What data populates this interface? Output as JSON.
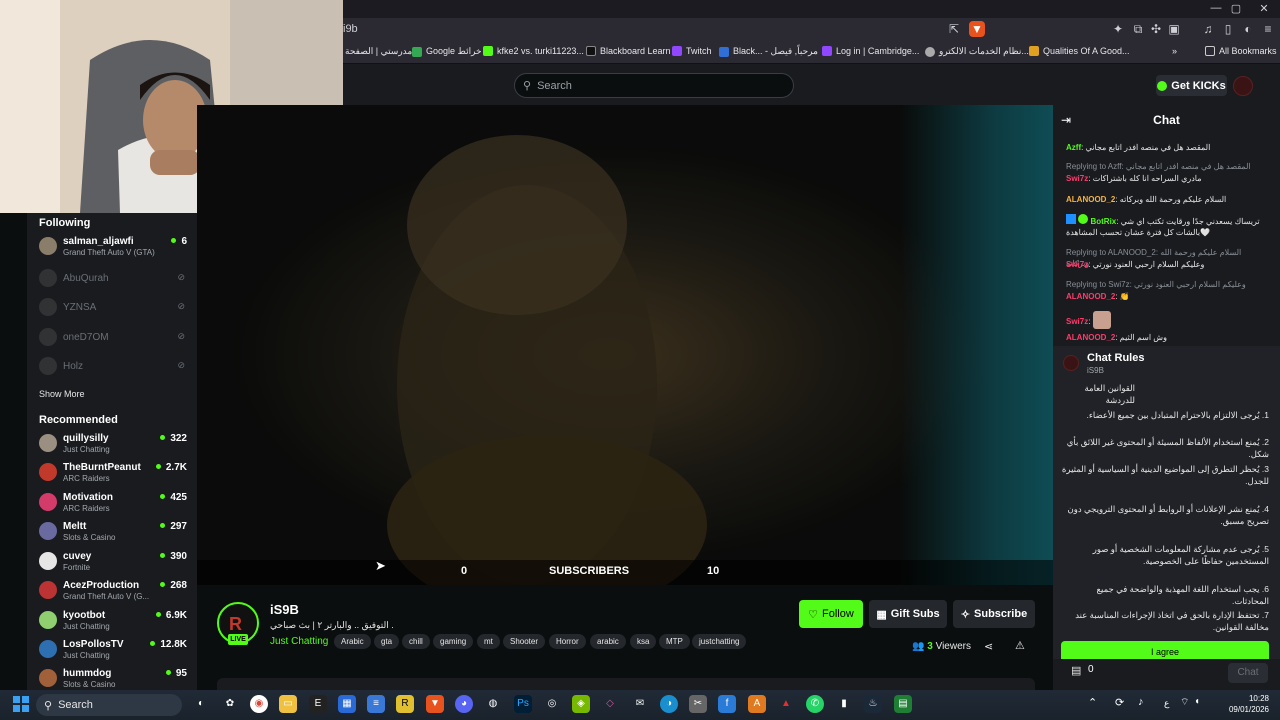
{
  "browser": {
    "url_partial": "i9b",
    "bookmarks": [
      "مدرستي | الصفحة",
      "Google خرائط",
      "kfke2 vs. turki11223...",
      "Blackboard Learn",
      "Twitch",
      "Black... - مرحباً, فيصل",
      "Log in | Cambridge...",
      "نظام الخدمات الالكترو...",
      "Qualities Of A Good...",
      "All Bookmarks"
    ],
    "window_controls": [
      "—",
      "▢",
      "✕"
    ]
  },
  "header": {
    "search_placeholder": "Search",
    "get_kicks_label": "Get KICKs"
  },
  "sidebar": {
    "following_heading": "Following",
    "following": [
      {
        "name": "salman_aljawfi",
        "category": "Grand Theft Auto V (GTA)",
        "viewers": "6",
        "live": true
      },
      {
        "name": "AbuQurah",
        "live": false
      },
      {
        "name": "YZNSA",
        "live": false
      },
      {
        "name": "oneD7OM",
        "live": false
      },
      {
        "name": "Holz",
        "live": false
      }
    ],
    "show_more_label": "Show More",
    "recommended_heading": "Recommended",
    "recommended": [
      {
        "name": "quillysilly",
        "category": "Just Chatting",
        "viewers": "322"
      },
      {
        "name": "TheBurntPeanut",
        "category": "ARC Raiders",
        "viewers": "2.7K"
      },
      {
        "name": "Motivation",
        "category": "ARC Raiders",
        "viewers": "425"
      },
      {
        "name": "Meltt",
        "category": "Slots & Casino",
        "viewers": "297"
      },
      {
        "name": "cuvey",
        "category": "Fortnite",
        "viewers": "390"
      },
      {
        "name": "AcezProduction",
        "category": "Grand Theft Auto V (G...",
        "viewers": "268"
      },
      {
        "name": "kyootbot",
        "category": "Just Chatting",
        "viewers": "6.9K"
      },
      {
        "name": "LosPollosTV",
        "category": "Just Chatting",
        "viewers": "12.8K"
      },
      {
        "name": "hummdog",
        "category": "Slots & Casino",
        "viewers": "95"
      }
    ]
  },
  "player": {
    "overlay_left": "0",
    "overlay_label": "SUBSCRIBERS",
    "overlay_right": "10"
  },
  "stream": {
    "channel_name": "iS9B",
    "live_label": "LIVE",
    "title": "التوفيق .. والبارتر ٢ | بث صباحي .",
    "category": "Just Chatting",
    "tags": [
      "Arabic",
      "gta",
      "chill",
      "gaming",
      "mt",
      "Shooter",
      "Horror",
      "arabic",
      "ksa",
      "MTP",
      "justchatting"
    ],
    "follow_label": "Follow",
    "gift_subs_label": "Gift Subs",
    "subscribe_label": "Subscribe",
    "viewers_count": "3",
    "viewers_label": "Viewers"
  },
  "chat": {
    "title": "Chat",
    "messages": [
      {
        "user": "Azff",
        "color": "#53fc18",
        "text": "المقصد هل في منصه افدر اتابع مجاني"
      },
      {
        "reply": "Replying to Azff: المقصد هل في منصه افدر اتابع مجاني",
        "user": "Swi7z",
        "color": "#ff3b6b",
        "text": "مادري السراحه انا كله باشتراكات"
      },
      {
        "user": "ALANOOD_2",
        "color": "#f5b342",
        "text": "السلام عليكم ورحمة الله وبركاته"
      },
      {
        "user": "BotRix",
        "color": "#53fc18",
        "text": "تريساك يسعدني جدًا ورقايت تكتب اي شي بالشات كل فترة عشان تحسب المشاهدة🤍"
      },
      {
        "reply": "Replying to ALANOOD_2: السلام عليكم ورحمة الله وبركاته",
        "user": "Swi7z",
        "color": "#ff3b6b",
        "text": "وعليكم السلام ارحبي العنود نورتي"
      },
      {
        "reply": "Replying to Swi7z: وعليكم السلام ارحبي العنود نورتي",
        "user": "ALANOOD_2",
        "color": "#ff3b6b",
        "text": "👏"
      },
      {
        "user": "Swi7z",
        "color": "#ff3b6b",
        "text": ""
      },
      {
        "user": "ALANOOD_2",
        "color": "#ff3b6b",
        "text": "وش اسم الثيم"
      }
    ],
    "rules_title": "Chat Rules",
    "rules_channel": "iS9B",
    "rules_heading": "القوانين العامة للدردشة",
    "rules": [
      "1.  يُرجى الالتزام بالاحترام المتبادل بين جميع الأعضاء.",
      "2.  يُمنع استخدام الألفاظ المسيئة أو المحتوى غير اللائق بأي شكل.",
      "3.  يُحظر التطرق إلى المواضيع الدينية أو السياسية أو المثيرة للجدل.",
      "4.  يُمنع نشر الإعلانات أو الروابط أو المحتوى الترويجي دون تصريح مسبق.",
      "5.  يُرجى عدم مشاركة المعلومات الشخصية أو صور المستخدمين حفاظًا على الخصوصية.",
      "6.  يجب استخدام اللغة المهذبة والواضحة في جميع المحادثات.",
      "7.  تحتفظ الإدارة بالحق في اتخاذ الإجراءات المناسبة عند مخالفة القوانين."
    ],
    "agree_label": "I agree",
    "gift_count": "0",
    "send_label": "Chat"
  },
  "taskbar": {
    "search_label": "Search",
    "time": "10:28",
    "date": "09/01/2026",
    "lang": "ع"
  }
}
